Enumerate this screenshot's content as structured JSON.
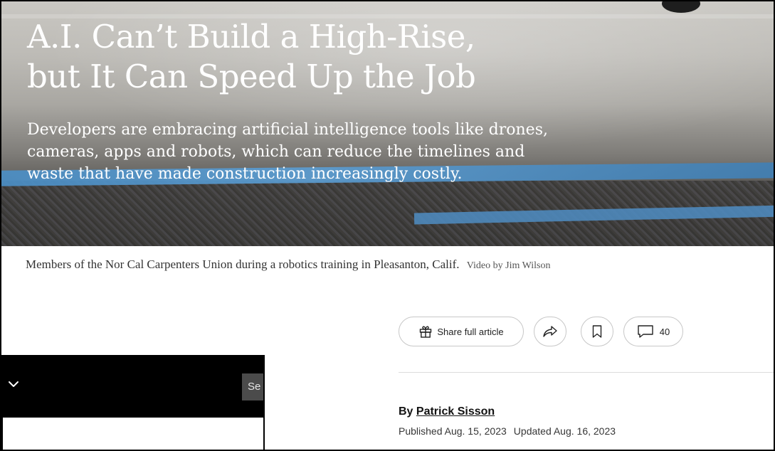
{
  "article": {
    "headline": "A.I. Can’t Build a High-Rise,\nbut It Can Speed Up the Job",
    "dek": "Developers are embracing artificial intelligence tools like drones,\ncameras, apps and robots, which can reduce the timelines and\nwaste that have made construction increasingly costly.",
    "caption": "Members of the Nor Cal Carpenters Union during a robotics training in Pleasanton, Calif.",
    "credit": "Video by Jim Wilson",
    "byline_prefix": "By ",
    "author": "Patrick Sisson",
    "published": "Published Aug. 15, 2023",
    "updated": "Updated Aug. 16, 2023"
  },
  "toolbar": {
    "share_full_label": "Share full article",
    "comment_count": "40",
    "icons": [
      "gift-icon",
      "share-arrow-icon",
      "bookmark-icon",
      "comment-bubble-icon"
    ]
  },
  "overlay_bar": {
    "search_label": "Se",
    "icons": [
      "chevron-down-icon"
    ]
  },
  "colors": {
    "hero_text": "#ffffff",
    "overlay_bar": "#000000",
    "overlay_button": "#4b4b4b",
    "pill_border": "#c7c7c7",
    "body_text": "#121212"
  }
}
